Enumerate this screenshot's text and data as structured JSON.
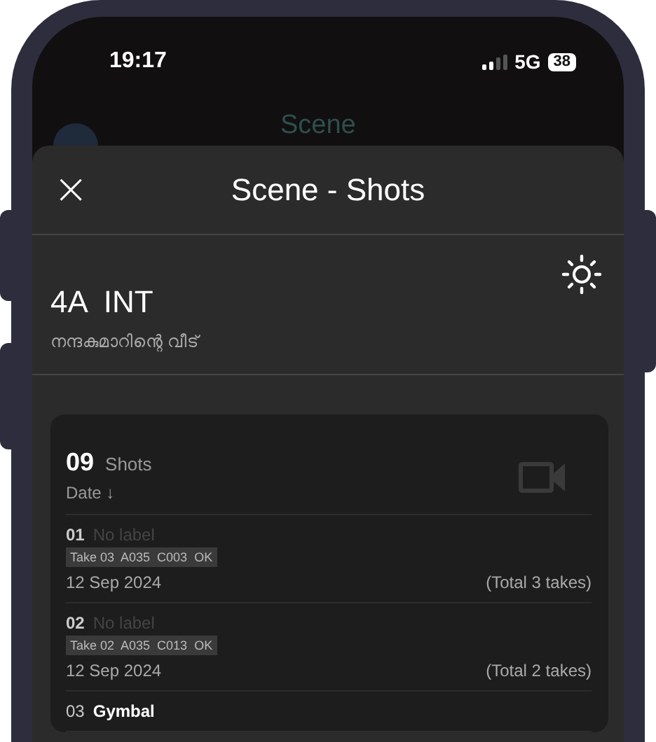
{
  "status_bar": {
    "time": "19:17",
    "network": "5G",
    "battery": "38"
  },
  "background_header": {
    "title": "Scene"
  },
  "sheet": {
    "title": "Scene - Shots",
    "close": "×",
    "scene": {
      "name": "4A  INT",
      "location": "നന്ദകുമാറിന്റെ വീട്"
    },
    "shots": {
      "count": "09",
      "label": "Shots",
      "sort": "Date",
      "sort_arrow": "↓",
      "items": [
        {
          "number": "01",
          "label": "No label",
          "muted": true,
          "tag": "Take 03  A035  C003  OK",
          "date": "12 Sep 2024",
          "total": "(Total 3 takes)"
        },
        {
          "number": "02",
          "label": "No label",
          "muted": true,
          "tag": "Take 02  A035  C013  OK",
          "date": "12 Sep 2024",
          "total": "(Total 2 takes)"
        },
        {
          "number": "03",
          "label": "Gymbal",
          "muted": false
        }
      ]
    }
  }
}
